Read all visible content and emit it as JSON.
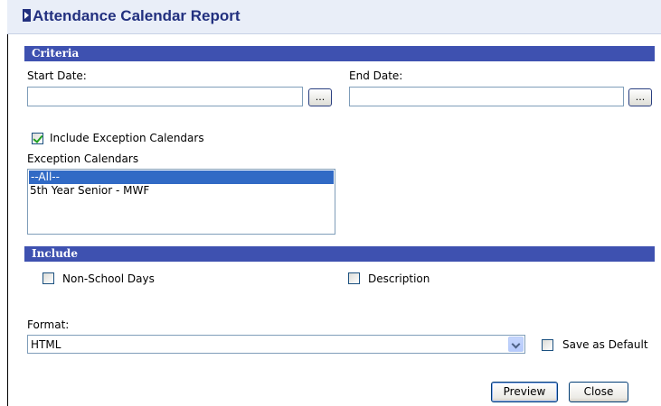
{
  "title": "Attendance Calendar Report",
  "criteria": {
    "section_label": "Criteria",
    "start_date": {
      "label": "Start Date:",
      "value": "",
      "picker_label": "..."
    },
    "end_date": {
      "label": "End Date:",
      "value": "",
      "picker_label": "..."
    },
    "include_exception_calendars": {
      "label": "Include Exception Calendars",
      "checked": true
    },
    "exception_calendars": {
      "label": "Exception Calendars",
      "options": [
        {
          "text": "--All--",
          "selected": true
        },
        {
          "text": "5th Year Senior - MWF",
          "selected": false
        }
      ]
    }
  },
  "include": {
    "section_label": "Include",
    "non_school_days": {
      "label": "Non-School Days",
      "checked": false
    },
    "description": {
      "label": "Description",
      "checked": false
    }
  },
  "format": {
    "label": "Format:",
    "selected": "HTML",
    "save_default": {
      "label": "Save as Default",
      "checked": false
    }
  },
  "buttons": {
    "preview": "Preview",
    "close": "Close"
  },
  "colors": {
    "section_bar": "#3e51b0",
    "title": "#22307f",
    "selection": "#316ac5"
  }
}
